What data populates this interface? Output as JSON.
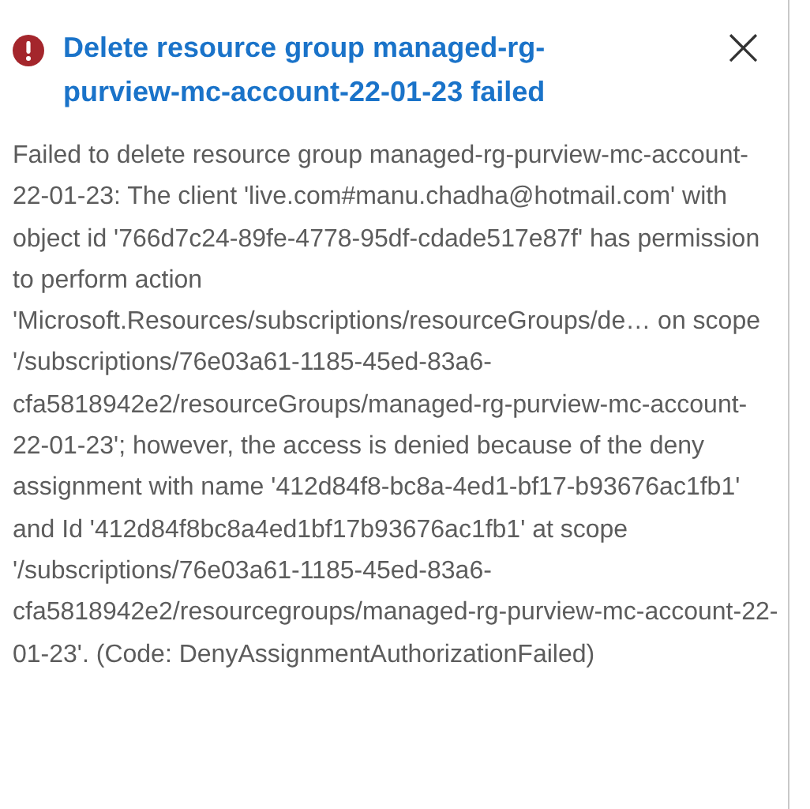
{
  "notification": {
    "kind": "error",
    "title": "Delete resource group managed-rg-purview-mc-account-22-01-23 failed",
    "close_label": "×",
    "message": "Failed to delete resource group managed-rg-purview-mc-account-22-01-23: The client 'live.com#manu.chadha@hotmail.com' with object id '766d7c24-89fe-4778-95df-cdade517e87f' has permission to perform action 'Microsoft.Resources/subscriptions/resourceGroups/de… on scope '/subscriptions/76e03a61-1185-45ed-83a6-cfa5818942e2/resourceGroups/managed-rg-purview-mc-account-22-01-23'; however, the access is denied because of the deny assignment with name '412d84f8-bc8a-4ed1-bf17-b93676ac1fb1' and Id '412d84f8bc8a4ed1bf17b93676ac1fb1' at scope '/subscriptions/76e03a61-1185-45ed-83a6-cfa5818942e2/resourcegroups/managed-rg-purview-mc-account-22-01-23'. (Code: DenyAssignmentAuthorizationFailed)"
  }
}
